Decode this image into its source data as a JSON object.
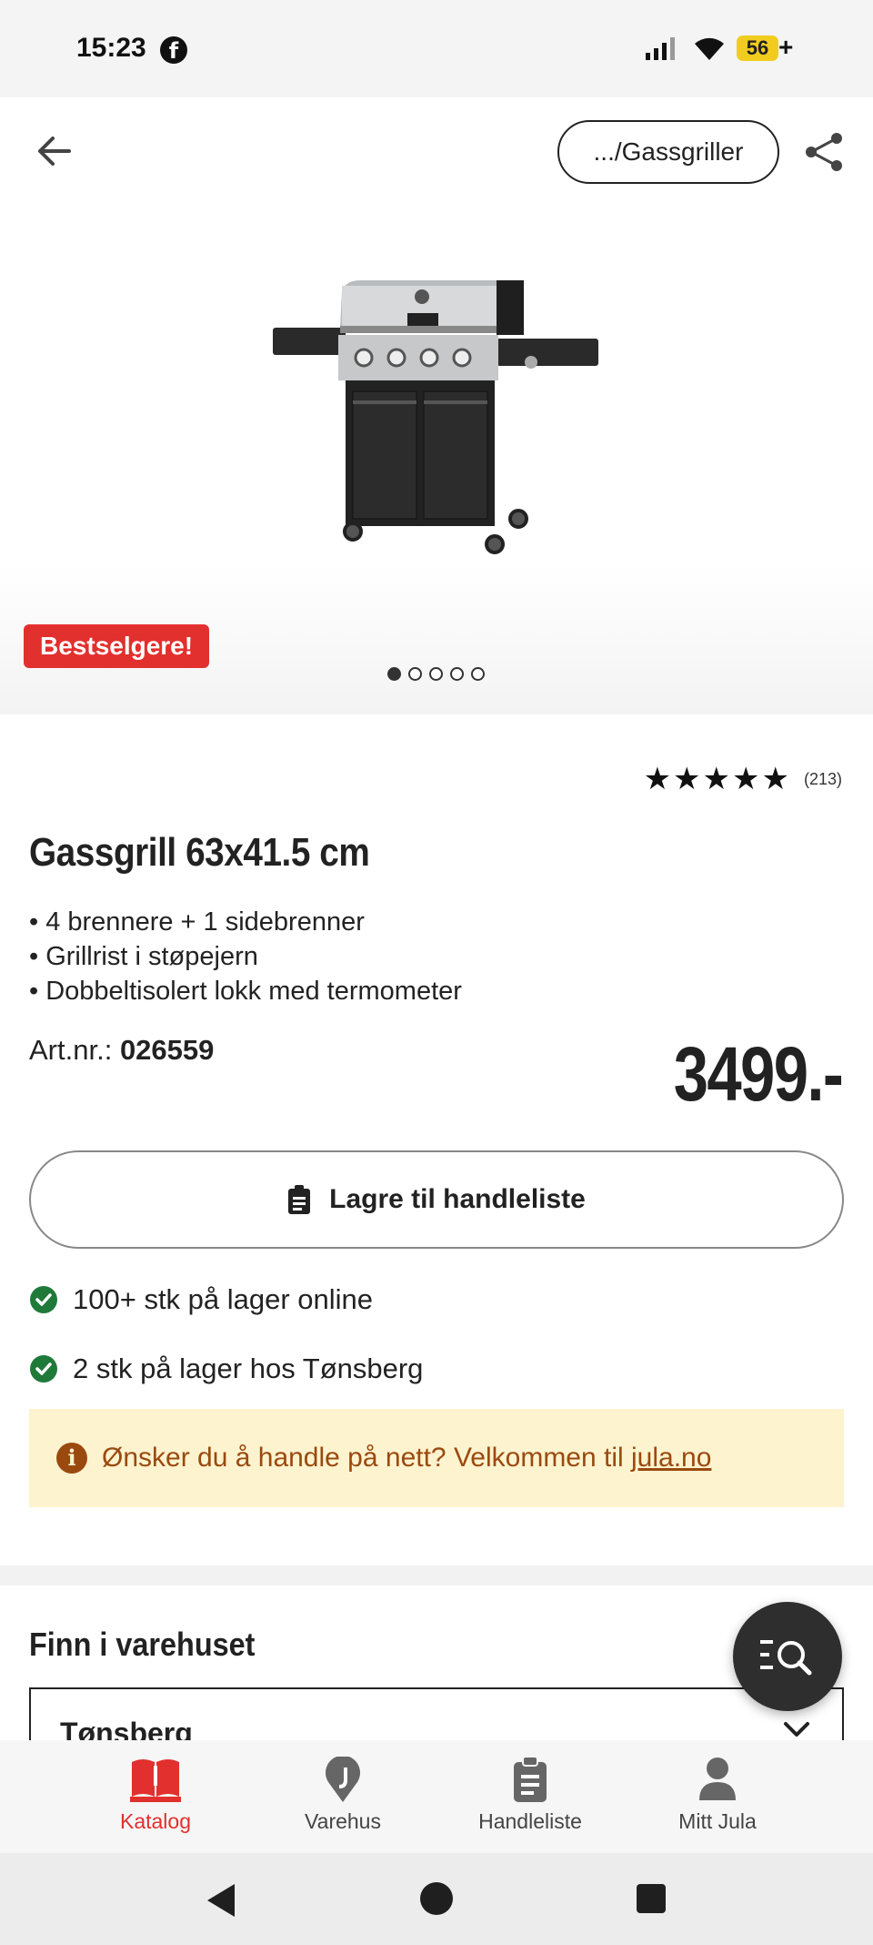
{
  "status_bar": {
    "time": "15:23",
    "app_icon": "facebook-icon",
    "battery": "56",
    "battery_suffix": "+"
  },
  "header": {
    "breadcrumb": ".../Gassgriller",
    "back_icon": "arrow-left-icon",
    "share_icon": "share-icon"
  },
  "gallery": {
    "badge": "Bestselgere!",
    "image_count": 5,
    "active_index": 0
  },
  "product": {
    "rating_stars": "★★★★★",
    "rating_value": 5,
    "rating_count": "(213)",
    "title": "Gassgrill 63x41.5 cm",
    "bullets": [
      "• 4 brennere + 1 sidebrenner",
      "• Grillrist i støpejern",
      "• Dobbeltisolert lokk med termometer"
    ],
    "artnr_label": "Art.nr.:",
    "artnr_value": "026559",
    "price": "3499.-"
  },
  "actions": {
    "save_label": "Lagre til handleliste"
  },
  "stock": {
    "online": "100+ stk på lager online",
    "store": "2 stk på lager hos Tønsberg"
  },
  "info_banner": {
    "text": "Ønsker du å handle på nett? Velkommen til ",
    "link": "jula.no"
  },
  "find_store": {
    "title": "Finn i varehuset",
    "selected_store": "Tønsberg"
  },
  "bottom_nav": {
    "items": [
      {
        "label": "Katalog",
        "icon": "book-icon"
      },
      {
        "label": "Varehus",
        "icon": "location-pin-icon"
      },
      {
        "label": "Handleliste",
        "icon": "clipboard-icon"
      },
      {
        "label": "Mitt Jula",
        "icon": "person-icon"
      }
    ]
  },
  "colors": {
    "brand_red": "#e1302e",
    "success_green": "#1f7a3a",
    "info_bg": "#fdf3cf",
    "info_text": "#9a4a0f"
  }
}
